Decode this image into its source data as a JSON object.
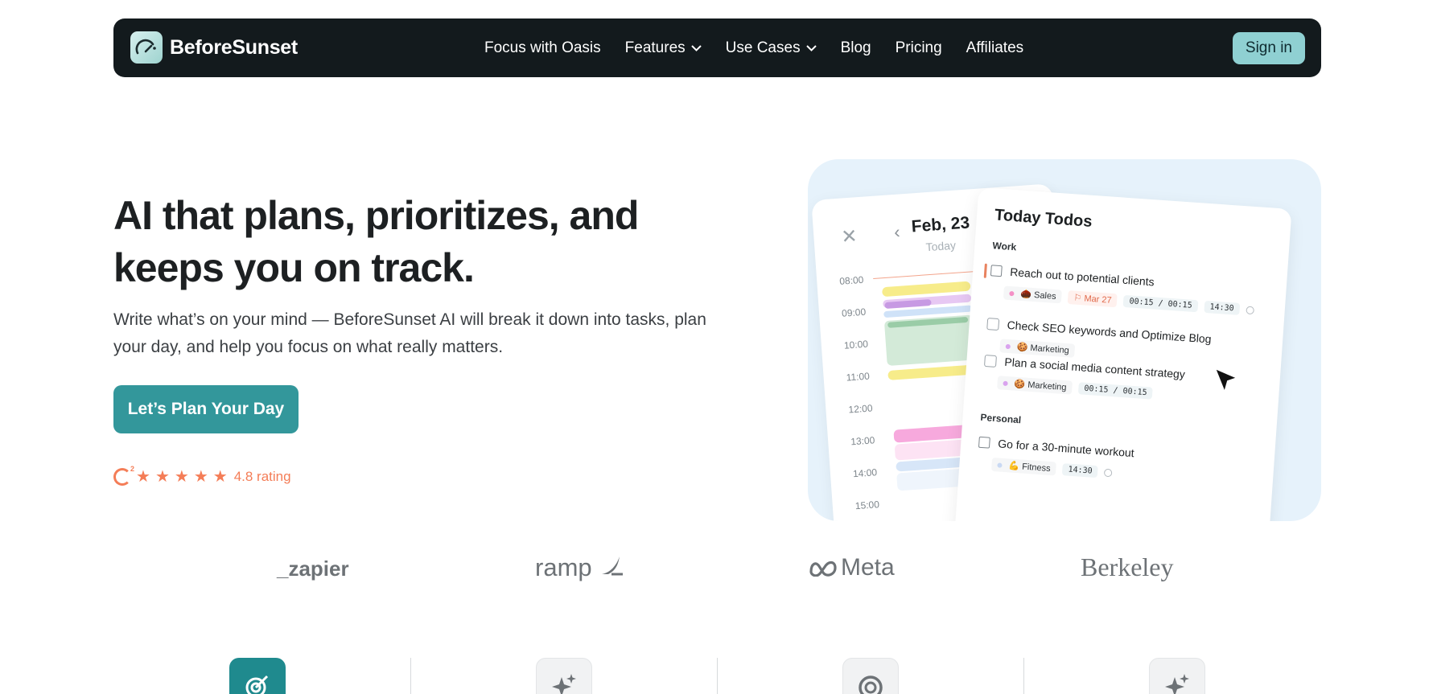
{
  "nav": {
    "brand": "BeforeSunset",
    "links": [
      "Focus with Oasis",
      "Features",
      "Use Cases",
      "Blog",
      "Pricing",
      "Affiliates"
    ],
    "signin": "Sign in"
  },
  "hero": {
    "title": "AI that plans, prioritizes, and keeps you on track.",
    "subtitle": "Write what’s on your mind — BeforeSunset AI will break it down into tasks, plan your day, and help you focus on what really matters.",
    "cta": "Let’s Plan Your Day",
    "rating_value": 4.8,
    "rating_text": "4.8 rating"
  },
  "calendar": {
    "date": "Feb, 23",
    "today": "Today",
    "hours": [
      "08:00",
      "09:00",
      "10:00",
      "11:00",
      "12:00",
      "13:00",
      "14:00",
      "15:00"
    ]
  },
  "todos": {
    "title": "Today Todos",
    "sections": [
      {
        "name": "Work",
        "tasks": [
          {
            "text": "Reach out to potential clients",
            "tag": "Sales",
            "date": "Mar 27",
            "duration": "00:15 / 00:15",
            "time": "14:30"
          },
          {
            "text": "Check SEO keywords and Optimize Blog",
            "tag": "Marketing"
          },
          {
            "text": "Plan a social media content strategy",
            "tag": "Marketing",
            "duration": "00:15 / 00:15"
          }
        ]
      },
      {
        "name": "Personal",
        "tasks": [
          {
            "text": "Go for a 30-minute workout",
            "tag": "Fitness",
            "time": "14:30"
          }
        ]
      }
    ]
  },
  "logos": [
    "_zapier",
    "ramp",
    "Meta",
    "Berkeley"
  ],
  "colors": {
    "nav_bg": "#131a1d",
    "accent": "#33979b",
    "signin_bg": "#8fd0d2",
    "rating": "#f47d57",
    "mock_bg": "#e6f2fb"
  }
}
